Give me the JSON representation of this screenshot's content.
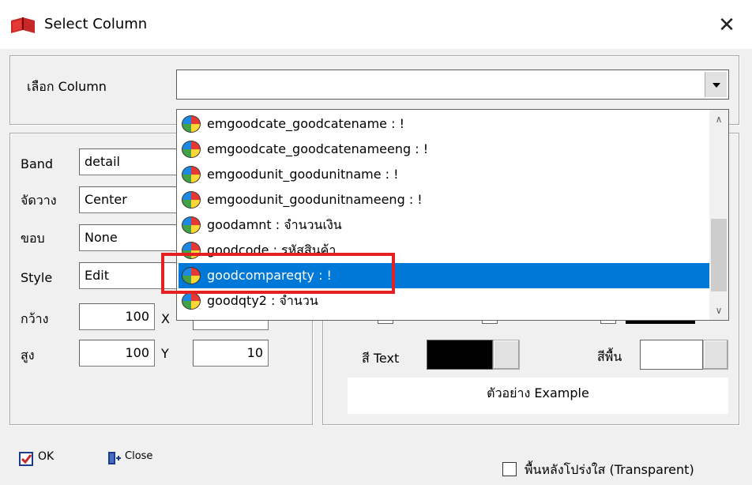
{
  "window": {
    "title": "Select Column",
    "close_glyph": "✕"
  },
  "column_select": {
    "label": "เลือก Column",
    "value": ""
  },
  "dropdown": {
    "items": [
      {
        "text": "emgoodcate_goodcatename : !"
      },
      {
        "text": "emgoodcate_goodcatenameeng : !"
      },
      {
        "text": "emgoodunit_goodunitname : !"
      },
      {
        "text": "emgoodunit_goodunitnameeng : !"
      },
      {
        "text": "goodamnt : จำนวนเงิน"
      },
      {
        "text": "goodcode : รหัสสินค้า"
      },
      {
        "text": "goodcompareqty : !"
      },
      {
        "text": "goodqty2 : จำนวน"
      }
    ],
    "selected_index": 6,
    "scroll_up": "∧",
    "scroll_down": "∨"
  },
  "props": {
    "band": {
      "label": "Band",
      "value": "detail"
    },
    "align": {
      "label": "จัดวาง",
      "value": "Center"
    },
    "border": {
      "label": "ขอบ",
      "value": "None"
    },
    "style": {
      "label": "Style",
      "value": "Edit"
    },
    "width": {
      "label": "กว้าง",
      "value": "100"
    },
    "height": {
      "label": "สูง",
      "value": "100"
    },
    "x": {
      "label": "X",
      "value": ""
    },
    "y": {
      "label": "Y",
      "value": "10"
    }
  },
  "colors": {
    "text_label": "สี Text",
    "text_color": "#000000",
    "bg_label": "สีพื้น",
    "bg_color": "#ffffff",
    "accent": "#0078d7",
    "highlight": "#e52020"
  },
  "preview": {
    "text": "ตัวอย่าง Example"
  },
  "buttons": {
    "ok": "OK",
    "close": "Close"
  },
  "transparent": {
    "label": "พื้นหลังโปร่งใส (Transparent)",
    "checked": false
  }
}
